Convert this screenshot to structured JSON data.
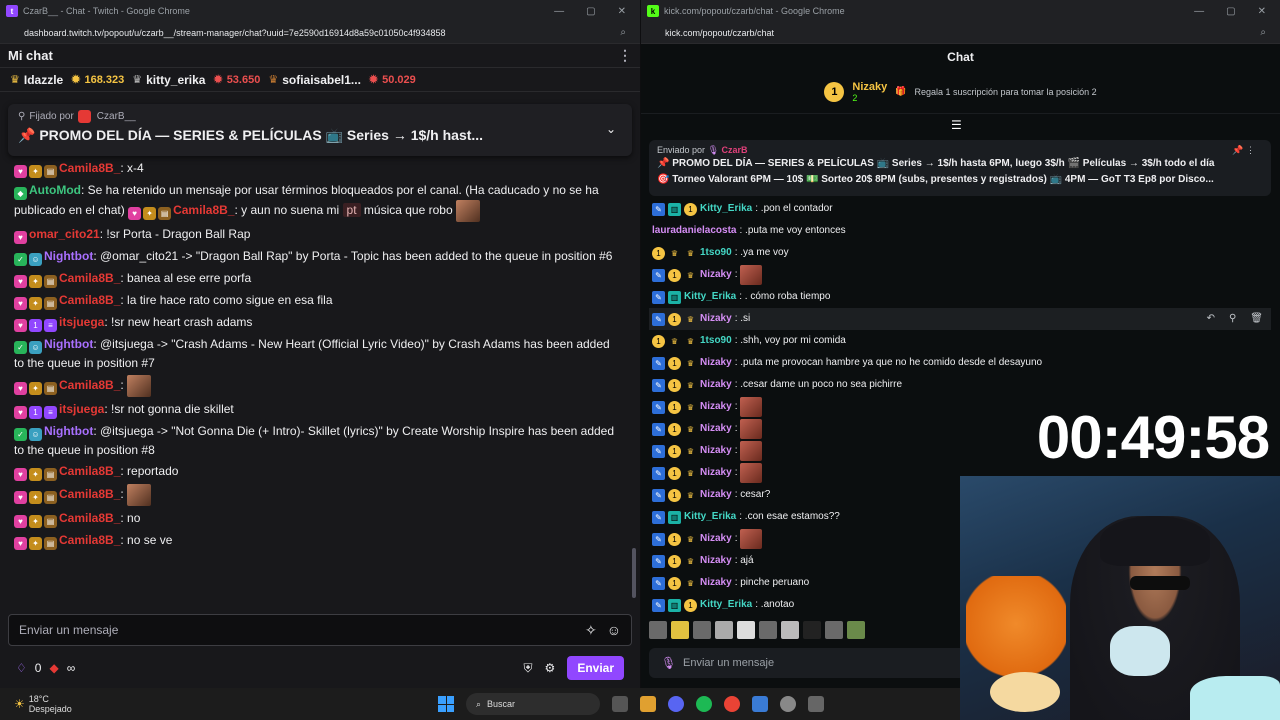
{
  "twitch": {
    "window_title": "CzarB__ - Chat - Twitch - Google Chrome",
    "url": "dashboard.twitch.tv/popout/u/czarb__/stream-manager/chat?uuid=7e2590d16914d8a59c01050c4f934858",
    "header_title": "Mi chat",
    "leaderboard": [
      {
        "name": "Idazzle",
        "amount": "",
        "color": "#efeff1"
      },
      {
        "name": "",
        "amount": "168.323",
        "color": "#f5c443"
      },
      {
        "name": "kitty_erika",
        "amount": "",
        "color": "#efeff1"
      },
      {
        "name": "",
        "amount": "53.650",
        "color": "#eb4f4f"
      },
      {
        "name": "sofiaisabel1...",
        "amount": "",
        "color": "#efeff1"
      },
      {
        "name": "",
        "amount": "50.029",
        "color": "#eb4f4f"
      }
    ],
    "pinned": {
      "by_prefix": "Fijado por",
      "by_user": "CzarB__",
      "message": "📌 PROMO DEL DÍA — SERIES & PELÍCULAS 📺 Series → 1$/h hast..."
    },
    "messages": [
      {
        "user": "Camila8B_",
        "text": ": x-4"
      },
      {
        "user": "AutoMod",
        "text": ": Se ha retenido un mensaje por usar términos bloqueados por el canal. (Ha caducado y no se ha publicado en el chat)"
      },
      {
        "user": "Camila8B_",
        "text": ": y aun no suena mi",
        "pt": "pt",
        "after": "música que robo"
      },
      {
        "user": "omar_cito21",
        "text": ": !sr Porta - Dragon Ball Rap"
      },
      {
        "user": "Nightbot",
        "text": ": @omar_cito21 -> \"Dragon Ball Rap\" by Porta - Topic has been added to the queue in position #6"
      },
      {
        "user": "Camila8B_",
        "text": ": banea al ese erre porfa"
      },
      {
        "user": "Camila8B_",
        "text": ": la tire hace rato como sigue en esa fila"
      },
      {
        "user": "itsjuega",
        "text": ": !sr new heart crash adams"
      },
      {
        "user": "Nightbot",
        "text": ": @itsjuega -> \"Crash Adams - New Heart (Official Lyric Video)\" by Crash Adams has been added to the queue in position #7"
      },
      {
        "user": "Camila8B_",
        "text": ":"
      },
      {
        "user": "itsjuega",
        "text": ": !sr not gonna die skillet"
      },
      {
        "user": "Nightbot",
        "text": ": @itsjuega -> \"Not Gonna Die (+ Intro)- Skillet (lyrics)\" by Create Worship Inspire has been added to the queue in position #8"
      },
      {
        "user": "Camila8B_",
        "text": ": reportado"
      },
      {
        "user": "Camila8B_",
        "text": ":"
      },
      {
        "user": "Camila8B_",
        "text": ": no"
      },
      {
        "user": "Camila8B_",
        "text": ": no se ve"
      }
    ],
    "input_placeholder": "Enviar un mensaje",
    "points": "0",
    "infinity": "∞",
    "send_label": "Enviar"
  },
  "kick": {
    "window_title": "kick.com/popout/czarb/chat - Google Chrome",
    "url": "kick.com/popout/czarb/chat",
    "header_title": "Chat",
    "top_gifter": {
      "rank": "1",
      "name": "Nizaky",
      "count": "2",
      "cta": "Regala 1 suscripción para tomar la posición 2"
    },
    "pinned": {
      "by_prefix": "Enviado por",
      "by_user": "CzarB",
      "line1": "📌 PROMO DEL DÍA — SERIES & PELÍCULAS 📺 Series → 1$/h hasta 6PM, luego 3$/h 🎬 Películas → 3$/h todo el día",
      "line2": "🎯 Torneo Valorant 6PM — 10$ 💵 Sorteo 20$ 8PM (subs, presentes y registrados) 📺 4PM — GoT T3 Ep8 por Disco..."
    },
    "messages": [
      {
        "user": "Kitty_Erika",
        "text": ": .pon el contador",
        "style": "teal"
      },
      {
        "user": "lauradanielacosta",
        "text": ": .puta me voy entonces",
        "style": "pink"
      },
      {
        "user": "1tso90",
        "text": ": .ya me voy",
        "style": "teal"
      },
      {
        "user": "Nizaky",
        "text": ":",
        "style": "pink"
      },
      {
        "user": "Kitty_Erika",
        "text": ": . cómo roba tiempo",
        "style": "teal"
      },
      {
        "user": "Nizaky",
        "text": ": .si",
        "style": "pink"
      },
      {
        "user": "1tso90",
        "text": ": .shh, voy por mi comida",
        "style": "teal"
      },
      {
        "user": "Nizaky",
        "text": ": .puta me provocan hambre ya que no he comido desde el desayuno",
        "style": "pink"
      },
      {
        "user": "Nizaky",
        "text": ": .cesar dame un poco no sea pichirre",
        "style": "pink"
      },
      {
        "user": "Nizaky",
        "text": ":",
        "style": "pink"
      },
      {
        "user": "Nizaky",
        "text": ":",
        "style": "pink"
      },
      {
        "user": "Nizaky",
        "text": ":",
        "style": "pink"
      },
      {
        "user": "Nizaky",
        "text": ":",
        "style": "pink"
      },
      {
        "user": "Nizaky",
        "text": ": cesar?",
        "style": "pink"
      },
      {
        "user": "Kitty_Erika",
        "text": ": .con esae estamos??",
        "style": "teal"
      },
      {
        "user": "Nizaky",
        "text": ":",
        "style": "pink"
      },
      {
        "user": "Nizaky",
        "text": ": ajá",
        "style": "pink"
      },
      {
        "user": "Nizaky",
        "text": ": pinche peruano",
        "style": "pink"
      },
      {
        "user": "Kitty_Erika",
        "text": ": .anotao",
        "style": "teal"
      }
    ],
    "input_placeholder": "Enviar un mensaje"
  },
  "overlay": {
    "timer": "00:49:58"
  },
  "taskbar": {
    "temp": "18°C",
    "weather": "Despejado",
    "search_label": "Buscar"
  }
}
